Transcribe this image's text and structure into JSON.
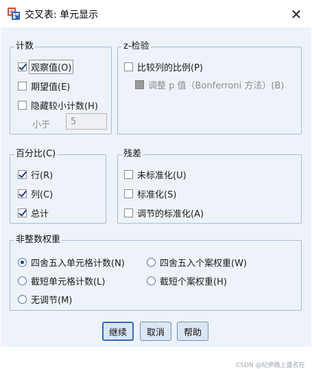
{
  "window": {
    "title": "交叉表: 单元显示",
    "close_symbol": "✕"
  },
  "counts": {
    "legend": "计数",
    "observed": "观察值(O)",
    "expected": "期望值(E)",
    "hide_small": "隐藏较小计数(H)",
    "less_than_label": "小于",
    "less_than_value": "5"
  },
  "ztest": {
    "legend": "z-检验",
    "compare_columns": "比较列的比例(P)",
    "adjust_p": "调整 p 值（Bonferroni 方法）(B)"
  },
  "percentages": {
    "legend": "百分比(C)",
    "row": "行(R)",
    "column": "列(C)",
    "total": "总计"
  },
  "residuals": {
    "legend": "残差",
    "unstandardized": "未标准化(U)",
    "standardized": "标准化(S)",
    "adjusted_standardized": "调节的标准化(A)"
  },
  "noninteger": {
    "legend": "非整数权重",
    "round_cell": "四舍五入单元格计数(N)",
    "round_case": "四舍五入个案权重(W)",
    "truncate_cell": "截短单元格计数(L)",
    "truncate_case": "截短个案权重(H)",
    "no_adjust": "无调节(M)"
  },
  "buttons": {
    "continue": "继续",
    "cancel": "取消",
    "help": "帮助"
  },
  "watermark": "CSDN @纪伊路上盛名在",
  "colors": {
    "background": "#eef3fa",
    "group_border": "#a8bcd3",
    "button_bg": "#dbe6f4",
    "check": "#1a3a8c"
  }
}
